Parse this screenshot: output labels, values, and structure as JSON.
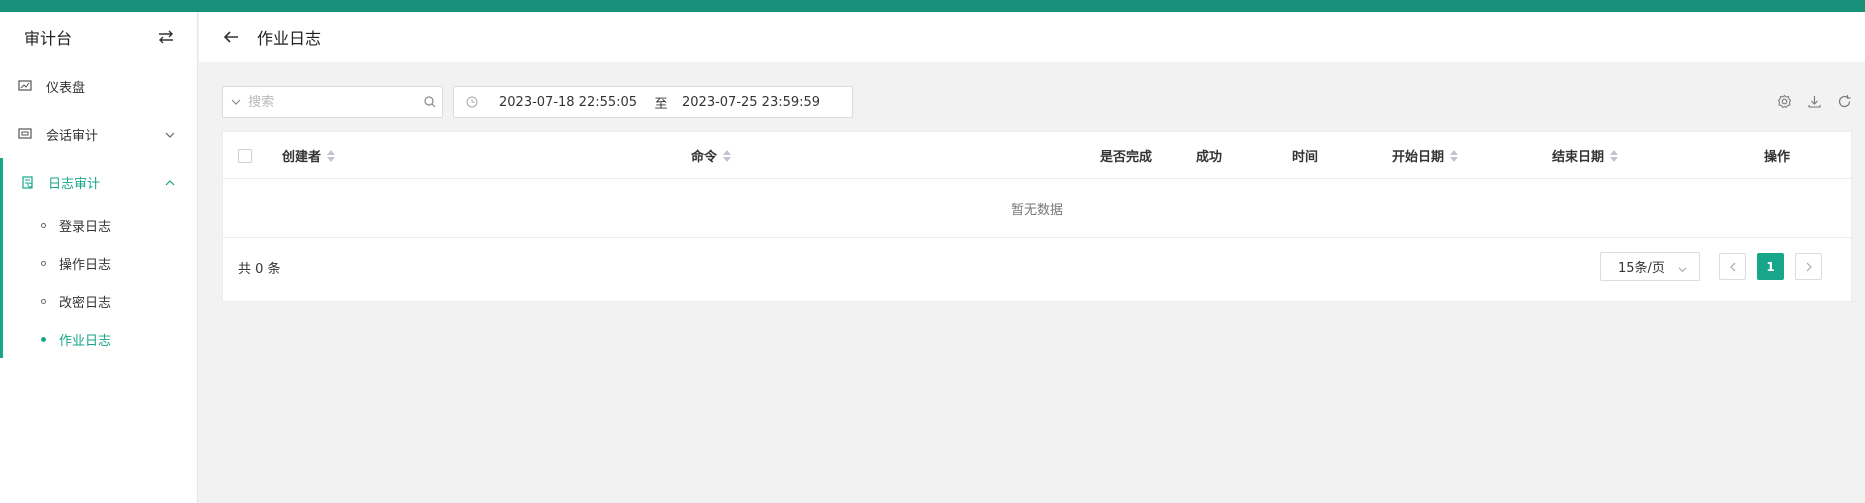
{
  "sidebar": {
    "title": "审计台",
    "items": [
      {
        "label": "仪表盘"
      },
      {
        "label": "会话审计"
      },
      {
        "label": "日志审计"
      }
    ],
    "sub_items": [
      {
        "label": "登录日志"
      },
      {
        "label": "操作日志"
      },
      {
        "label": "改密日志"
      },
      {
        "label": "作业日志"
      }
    ]
  },
  "header": {
    "title": "作业日志"
  },
  "toolbar": {
    "search_placeholder": "搜索",
    "date_start": "2023-07-18 22:55:05",
    "date_sep": "至",
    "date_end": "2023-07-25 23:59:59"
  },
  "table": {
    "columns": [
      "创建者",
      "命令",
      "是否完成",
      "成功",
      "时间",
      "开始日期",
      "结束日期",
      "操作"
    ],
    "empty_text": "暂无数据"
  },
  "pagination": {
    "total_text": "共 0 条",
    "page_size": "15条/页",
    "current_page": "1"
  },
  "colors": {
    "topbar": "#17907a",
    "accent": "#17a689"
  }
}
